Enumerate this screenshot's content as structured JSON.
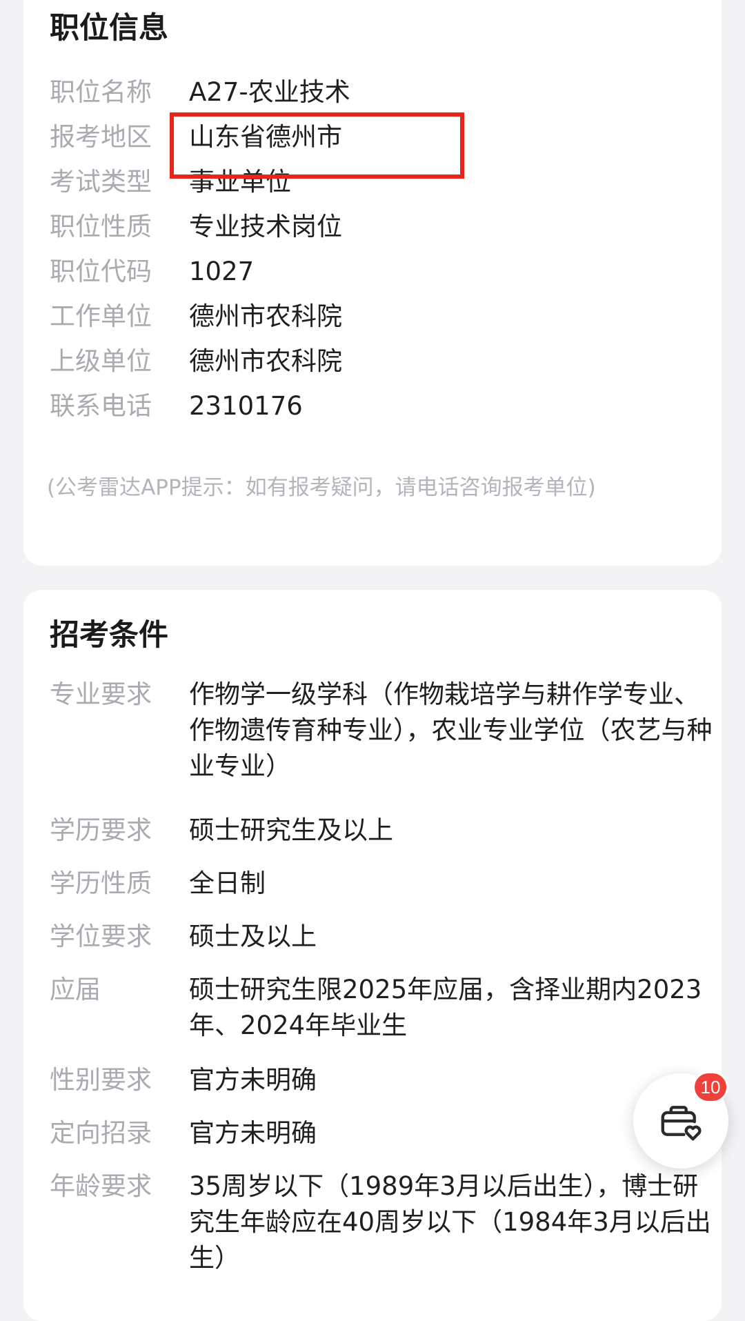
{
  "job_info": {
    "title": "职位信息",
    "rows": [
      {
        "label": "职位名称",
        "value": "A27-农业技术"
      },
      {
        "label": "报考地区",
        "value": "山东省德州市"
      },
      {
        "label": "考试类型",
        "value": "事业单位"
      },
      {
        "label": "职位性质",
        "value": "专业技术岗位"
      },
      {
        "label": "职位代码",
        "value": "1027"
      },
      {
        "label": "工作单位",
        "value": "德州市农科院"
      },
      {
        "label": "上级单位",
        "value": "德州市农科院"
      },
      {
        "label": "联系电话",
        "value": "2310176"
      }
    ],
    "tip": "(公考雷达APP提示：如有报考疑问，请电话咨询报考单位)",
    "highlight_color": "#e8251c"
  },
  "requirements": {
    "title": "招考条件",
    "rows": [
      {
        "label": "专业要求",
        "value": "作物学一级学科（作物栽培学与耕作学专业、作物遗传育种专业），农业专业学位（农艺与种业专业）"
      },
      {
        "label": "学历要求",
        "value": "硕士研究生及以上"
      },
      {
        "label": "学历性质",
        "value": "全日制"
      },
      {
        "label": "学位要求",
        "value": "硕士及以上"
      },
      {
        "label": "应届",
        "value": "硕士研究生限2025年应届，含择业期内2023年、2024年毕业生"
      },
      {
        "label": "性别要求",
        "value": "官方未明确"
      },
      {
        "label": "定向招录",
        "value": "官方未明确"
      },
      {
        "label": "年龄要求",
        "value": "35周岁以下（1989年3月以后出生），博士研究生年龄应在40周岁以下（1984年3月以后出生）"
      }
    ]
  },
  "floating_button": {
    "icon": "briefcase-heart-icon",
    "badge_count": "10",
    "badge_color": "#f0403b"
  }
}
